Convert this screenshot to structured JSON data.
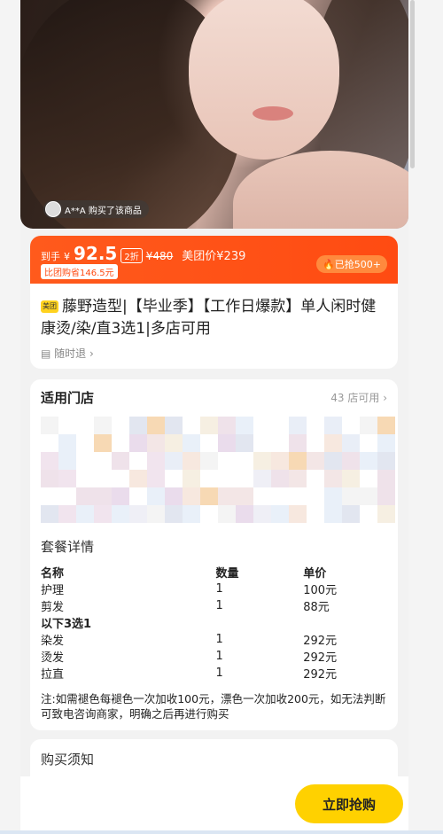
{
  "hero": {
    "buyer_text": "A**A 购买了该商品"
  },
  "price": {
    "prefix": "到手",
    "currency": "¥",
    "main": "92.5",
    "discount": "2折",
    "original": "¥480",
    "meituan_price": "美团价¥239",
    "savings": "比团购省146.5元",
    "sold": "🔥已抢500+"
  },
  "product": {
    "badge": "美团",
    "title": "藤野造型|【毕业季】【工作日爆款】单人闲时健康烫/染/直3选1|多店可用",
    "refund": "随时退 ›"
  },
  "stores": {
    "heading": "适用门店",
    "count": "43 店可用 ›"
  },
  "package": {
    "heading": "套餐详情",
    "columns": [
      "名称",
      "数量",
      "单价"
    ],
    "rows": [
      {
        "name": "护理",
        "qty": "1",
        "price": "100元"
      },
      {
        "name": "剪发",
        "qty": "1",
        "price": "88元"
      },
      {
        "group": "以下3选1"
      },
      {
        "name": "染发",
        "qty": "1",
        "price": "292元"
      },
      {
        "name": "烫发",
        "qty": "1",
        "price": "292元"
      },
      {
        "name": "拉直",
        "qty": "1",
        "price": "292元"
      }
    ],
    "note": "注:如需褪色每褪色一次加收100元，漂色一次加收200元，如无法判断可致电咨询商家，明确之后再进行购买"
  },
  "notice": {
    "heading": "购买须知"
  },
  "cta": {
    "buy_label": "立即抢购"
  },
  "colors": {
    "orange": "#ff4b12",
    "yellow": "#ffd100"
  }
}
